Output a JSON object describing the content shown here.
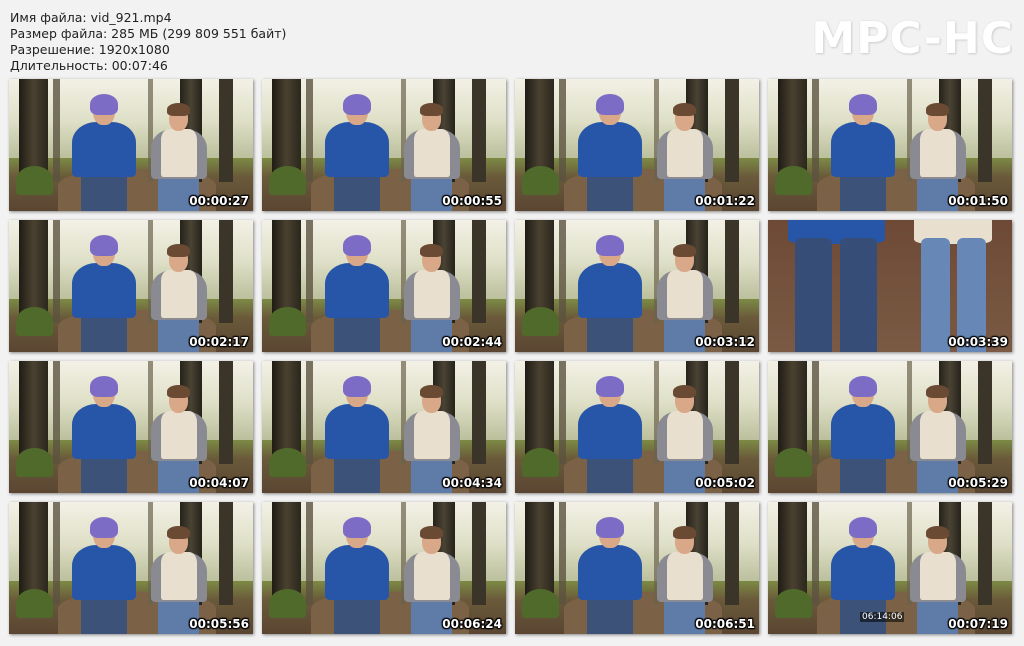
{
  "file_info": {
    "name_line": "Имя файла: vid_921.mp4",
    "size_line": "Размер файла: 285 МБ (299 809 551 байт)",
    "resolution_line": "Разрешение: 1920x1080",
    "duration_line": "Длительность: 00:07:46"
  },
  "logo": "MPC-HC",
  "thumbnails": [
    {
      "time": "00:00:27"
    },
    {
      "time": "00:00:55"
    },
    {
      "time": "00:01:22"
    },
    {
      "time": "00:01:50"
    },
    {
      "time": "00:02:17"
    },
    {
      "time": "00:02:44"
    },
    {
      "time": "00:03:12"
    },
    {
      "time": "00:03:39"
    },
    {
      "time": "00:04:07"
    },
    {
      "time": "00:04:34"
    },
    {
      "time": "00:05:02"
    },
    {
      "time": "00:05:29"
    },
    {
      "time": "00:05:56"
    },
    {
      "time": "00:06:24"
    },
    {
      "time": "00:06:51"
    },
    {
      "time": "00:07:19"
    }
  ],
  "last_thumb_overlay": "06:14:06"
}
